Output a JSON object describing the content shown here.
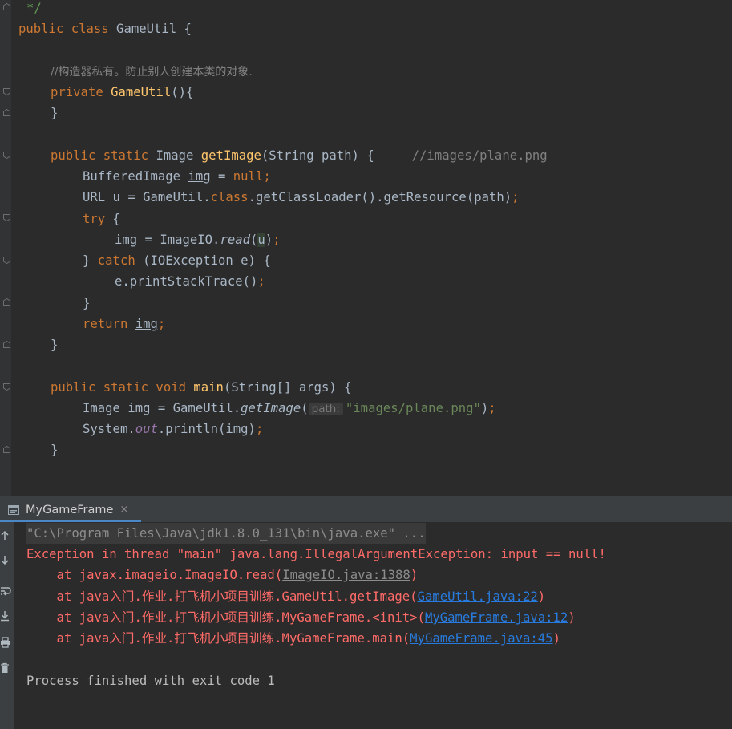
{
  "editor": {
    "lines": {
      "l0": "*/",
      "l1_kw": "public class",
      "l1_name": " GameUtil {",
      "l3": "//构造器私有。防止别人创建本类的对象.",
      "l4_kw": "private",
      "l4_fn": "GameUtil",
      "l4_rest": "(){",
      "l5": "}",
      "l7_kw": "public static",
      "l7_type": " Image ",
      "l7_fn": "getImage",
      "l7_rest": "(String path) {     ",
      "l7_cm": "//images/plane.png",
      "l8_type": "BufferedImage ",
      "l8_var": "img",
      "l8_eq": " = ",
      "l8_null": "null",
      "l8_semi": ";",
      "l9_a": "URL u = GameUtil.",
      "l9_class": "class",
      "l9_b": ".getClassLoader().getResource(path)",
      "l9_semi": ";",
      "l10_kw": "try",
      "l10_rest": " {",
      "l11_var": "img",
      "l11_a": " = ImageIO.",
      "l11_read": "read",
      "l11_b": "(",
      "l11_u": "u",
      "l11_c": ")",
      "l11_semi": ";",
      "l12_a": "} ",
      "l12_kw": "catch",
      "l12_rest": " (IOException e) {",
      "l13_a": "e.printStackTrace()",
      "l13_semi": ";",
      "l14": "}",
      "l15_kw": "return ",
      "l15_var": "img",
      "l15_semi": ";",
      "l16": "}",
      "l18_kw": "public static void",
      "l18_fn": " main",
      "l18_rest": "(String[] args) {",
      "l19_a": "Image img = GameUtil.",
      "l19_fn": "getImage",
      "l19_b": "(",
      "l19_hint": "path:",
      "l19_str": "\"images/plane.png\"",
      "l19_c": ")",
      "l19_semi": ";",
      "l20_a": "System.",
      "l20_out": "out",
      "l20_b": ".println(img)",
      "l20_semi": ";",
      "l21": "}"
    }
  },
  "run_panel": {
    "tab_label": "MyGameFrame",
    "close": "×"
  },
  "console": {
    "command": "\"C:\\Program Files\\Java\\jdk1.8.0_131\\bin\\java.exe\" ...",
    "exception": "Exception in thread \"main\" java.lang.IllegalArgumentException: input == null!",
    "trace": [
      {
        "prefix": "    at javax.imageio.ImageIO.read(",
        "link": "ImageIO.java:1388",
        "suffix": ")"
      },
      {
        "prefix": "    at java入门.作业.打飞机小项目训练.GameUtil.getImage(",
        "link": "GameUtil.java:22",
        "suffix": ")"
      },
      {
        "prefix": "    at java入门.作业.打飞机小项目训练.MyGameFrame.<init>(",
        "link": "MyGameFrame.java:12",
        "suffix": ")"
      },
      {
        "prefix": "    at java入门.作业.打飞机小项目训练.MyGameFrame.main(",
        "link": "MyGameFrame.java:45",
        "suffix": ")"
      }
    ],
    "exit": "Process finished with exit code 1"
  },
  "icons": {
    "fold": "fold-marker-icon",
    "console_tools": [
      "up-arrow-icon",
      "down-arrow-icon",
      "soft-wrap-icon",
      "scroll-to-end-icon",
      "print-icon",
      "trash-icon"
    ]
  },
  "colors": {
    "editor_bg": "#2b2b2b",
    "keyword": "#cc7832",
    "function": "#ffc66d",
    "string": "#6a8759",
    "comment": "#808080",
    "error": "#ff6b68",
    "link": "#287bde"
  }
}
